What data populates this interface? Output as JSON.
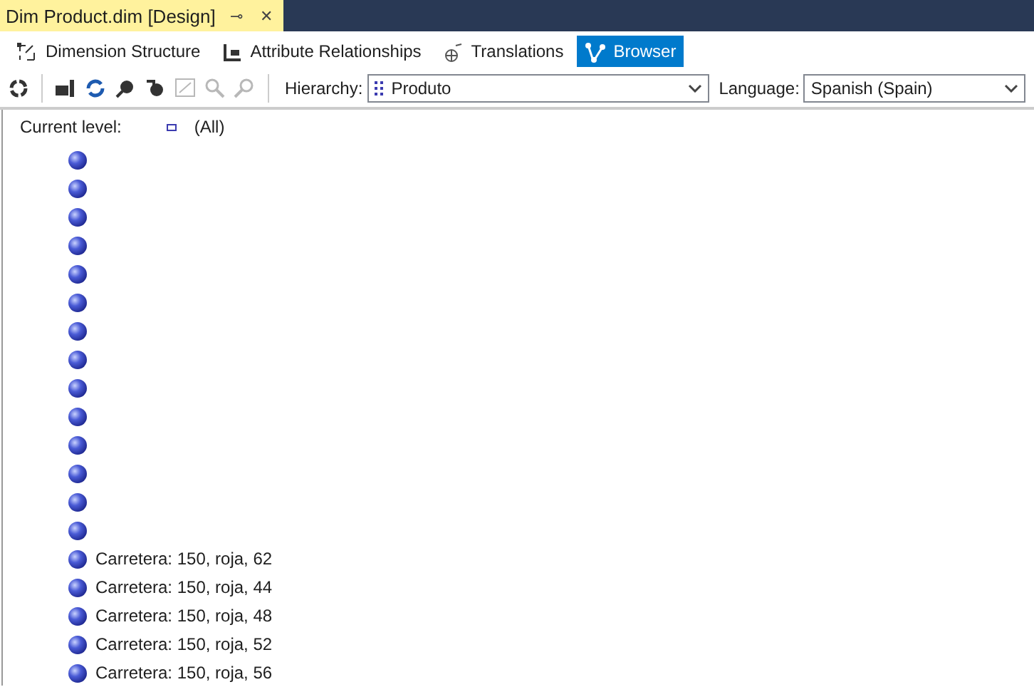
{
  "document_tab": {
    "title": "Dim Product.dim [Design]",
    "pin": "⊸",
    "close": "✕"
  },
  "designer_tabs": [
    {
      "label": "Dimension Structure",
      "selected": false
    },
    {
      "label": "Attribute Relationships",
      "selected": false
    },
    {
      "label": "Translations",
      "selected": false
    },
    {
      "label": "Browser",
      "selected": true
    }
  ],
  "toolbar": [
    {
      "kind": "reconnect",
      "disabled": false
    },
    {
      "kind": "process",
      "disabled": false
    },
    {
      "kind": "refresh",
      "disabled": false
    },
    {
      "kind": "member-properties",
      "disabled": false
    },
    {
      "kind": "undo",
      "disabled": false
    },
    {
      "kind": "filter",
      "disabled": true
    },
    {
      "kind": "zoom-in",
      "disabled": true
    },
    {
      "kind": "zoom-out",
      "disabled": true
    }
  ],
  "hierarchy": {
    "label": "Hierarchy:",
    "value": "Produto"
  },
  "language": {
    "label": "Language:",
    "value": "Spanish (Spain)"
  },
  "current_level": {
    "label": "Current level:",
    "value": "(All)"
  },
  "members": [
    {
      "kind": "blank"
    },
    {
      "kind": "blank"
    },
    {
      "kind": "blank"
    },
    {
      "kind": "blank"
    },
    {
      "kind": "blank"
    },
    {
      "kind": "blank"
    },
    {
      "kind": "blank"
    },
    {
      "kind": "blank"
    },
    {
      "kind": "blank"
    },
    {
      "kind": "blank"
    },
    {
      "kind": "blank"
    },
    {
      "kind": "blank"
    },
    {
      "kind": "blank"
    },
    {
      "kind": "blank"
    },
    {
      "kind": "named",
      "caption": "Carretera: 150, roja, 62"
    },
    {
      "kind": "named",
      "caption": "Carretera: 150, roja, 44"
    },
    {
      "kind": "named",
      "caption": "Carretera: 150, roja, 48"
    },
    {
      "kind": "named",
      "caption": "Carretera: 150, roja, 52"
    },
    {
      "kind": "named",
      "caption": "Carretera: 150, roja, 56"
    }
  ]
}
